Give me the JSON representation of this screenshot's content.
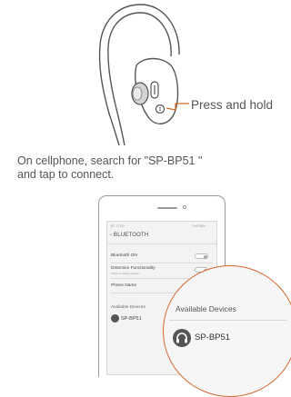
{
  "callout": {
    "press_hold": "Press and hold"
  },
  "instruction": {
    "line1": "On cellphone, search for \"SP-BP51 \"",
    "line2": "and tap to connect."
  },
  "phone_screen": {
    "status_left": "BT 17:00",
    "status_right": "Full  85%",
    "back_icon": "chevron-left-icon",
    "title": "BLUETOOTH",
    "rows": [
      {
        "label": "Bluetooth ON",
        "toggle": true
      },
      {
        "label": "Detection Functionality",
        "sub": "Visible to nearby devices",
        "toggle": true
      },
      {
        "label": "Phone Name"
      }
    ],
    "available_label": "Available Devices",
    "device_name": "SP-BP51"
  },
  "magnifier": {
    "title": "Available Devices",
    "device_name": "SP-BP51",
    "device_icon": "headphones-icon",
    "accent_color": "#d7682f"
  }
}
